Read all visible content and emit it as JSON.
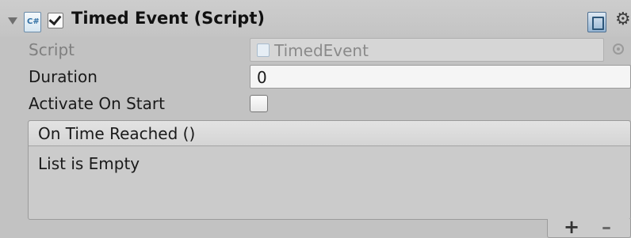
{
  "component": {
    "title": "Timed Event (Script)",
    "enabled": true,
    "icons": {
      "foldout": "triangle-down-icon",
      "script": "csharp-script-icon",
      "help": "help-book-icon",
      "settings": "gear-icon"
    }
  },
  "properties": {
    "script": {
      "label": "Script",
      "value": "TimedEvent"
    },
    "duration": {
      "label": "Duration",
      "value": "0"
    },
    "activate_on_start": {
      "label": "Activate On Start",
      "checked": false
    }
  },
  "event": {
    "header": "On Time Reached ()",
    "empty_text": "List is Empty",
    "add_label": "+",
    "remove_label": "–"
  }
}
